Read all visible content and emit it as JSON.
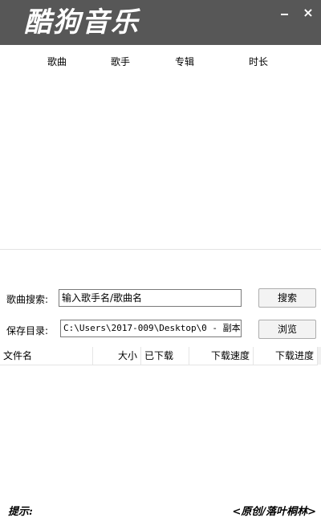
{
  "window": {
    "logo_text": "酷狗音乐",
    "close_glyph": "×"
  },
  "song_list": {
    "columns": [
      "歌曲",
      "歌手",
      "专辑",
      "时长"
    ]
  },
  "search": {
    "label": "歌曲搜索:",
    "input_value": "输入歌手名/歌曲名",
    "button": "搜索"
  },
  "save_dir": {
    "label": "保存目录:",
    "path": "C:\\Users\\2017-009\\Desktop\\0 - 副本",
    "button": "浏览"
  },
  "download_list": {
    "columns": [
      "文件名",
      "大小",
      "已下载",
      "下载速度",
      "下载进度"
    ]
  },
  "footer": {
    "hint_label": "提示:",
    "credit": "<原创/落叶桐林>"
  },
  "colors": {
    "titlebar": "#575757"
  }
}
